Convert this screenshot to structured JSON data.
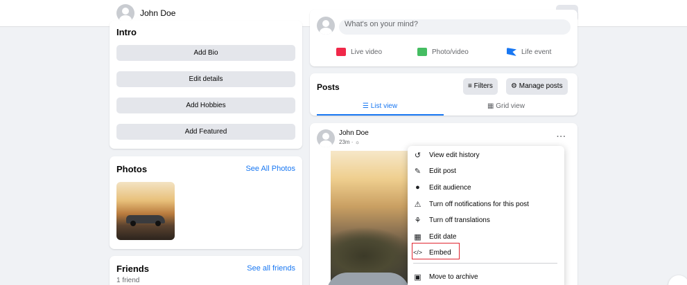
{
  "topbar": {
    "profile_name": "John Doe",
    "more": "···"
  },
  "intro": {
    "title": "Intro",
    "buttons": [
      "Add Bio",
      "Edit details",
      "Add Hobbies",
      "Add Featured"
    ]
  },
  "photos": {
    "title": "Photos",
    "link": "See All Photos"
  },
  "friends": {
    "title": "Friends",
    "link": "See all friends",
    "count": "1 friend"
  },
  "composer": {
    "placeholder": "What's on your mind?",
    "actions": [
      "Live video",
      "Photo/video",
      "Life event"
    ]
  },
  "posts": {
    "title": "Posts",
    "filters": "Filters",
    "manage": "Manage posts",
    "tabs": [
      "List view",
      "Grid view"
    ]
  },
  "post": {
    "author": "John Doe",
    "time": "23m ·",
    "more": "···"
  },
  "menu": {
    "items": [
      "View edit history",
      "Edit post",
      "Edit audience",
      "Turn off notifications for this post",
      "Turn off translations",
      "Edit date",
      "Embed",
      "Move to archive"
    ]
  },
  "colors": {
    "accent": "#1877f2",
    "highlight": "#e0242f",
    "live": "#f02849",
    "photo": "#45bd62",
    "life": "#1877f2"
  }
}
